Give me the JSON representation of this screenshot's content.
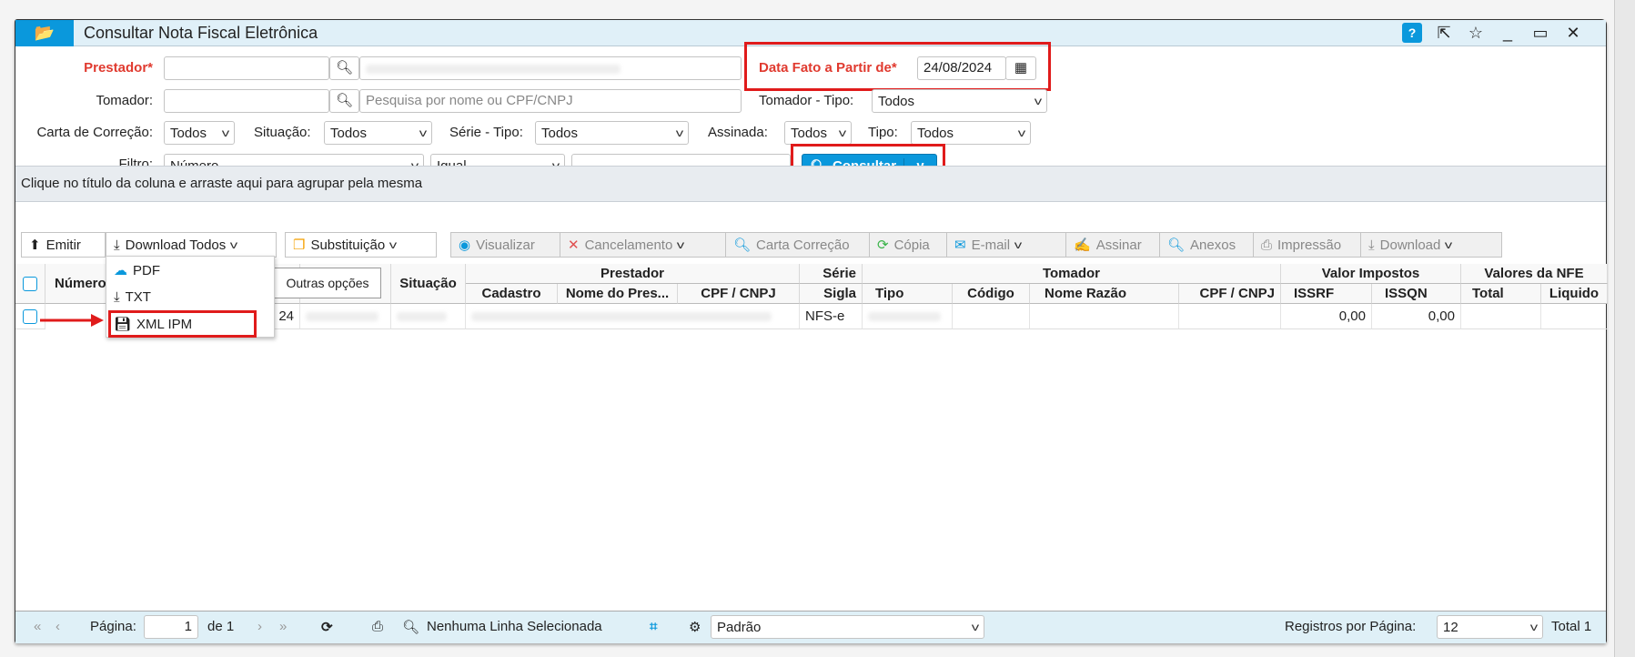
{
  "window": {
    "title": "Consultar Nota Fiscal Eletrônica",
    "help_label": "?"
  },
  "form": {
    "prestador_label": "Prestador*",
    "tomador_label": "Tomador:",
    "tomador_placeholder": "Pesquisa por nome ou CPF/CNPJ",
    "data_fato_label": "Data Fato a Partir de*",
    "data_fato_value": "24/08/2024",
    "tomador_tipo_label": "Tomador - Tipo:",
    "tomador_tipo_value": "Todos",
    "carta_label": "Carta de Correção:",
    "carta_value": "Todos",
    "situacao_label": "Situação:",
    "situacao_value": "Todos",
    "serie_label": "Série - Tipo:",
    "serie_value": "Todos",
    "assinada_label": "Assinada:",
    "assinada_value": "Todos",
    "tipo_label": "Tipo:",
    "tipo_value": "Todos",
    "filtro_label": "Filtro:",
    "filtro_field": "Número",
    "filtro_op": "Igual",
    "filtro_value": "",
    "consultar_label": "Consultar"
  },
  "group_hint": "Clique no título da coluna e arraste aqui para agrupar pela mesma",
  "toolbar": [
    "Emitir",
    "Download Todos",
    "Substituição",
    "Visualizar",
    "Cancelamento",
    "Carta Correção",
    "Cópia",
    "E-mail",
    "Assinar",
    "Anexos",
    "Impressão",
    "Download"
  ],
  "download_menu": [
    "PDF",
    "TXT",
    "XML IPM"
  ],
  "tooltip": "Outras opções",
  "table": {
    "groups": {
      "prestador": "Prestador",
      "serie": "Série",
      "tomador": "Tomador",
      "impostos": "Valor Impostos",
      "valores": "Valores da NFE"
    },
    "columns": {
      "numero": "Número",
      "situacao": "Situação",
      "cadastro": "Cadastro",
      "nome_prest": "Nome do Pres...",
      "cpf_prest": "CPF / CNPJ",
      "sigla": "Sigla",
      "tipo": "Tipo",
      "codigo": "Código",
      "nome_razao": "Nome Razão",
      "cpf_tom": "CPF / CNPJ",
      "issrf": "ISSRF",
      "issqn": "ISSQN",
      "total": "Total",
      "liquido": "Liquido"
    },
    "rows": [
      {
        "col2_tail": "24",
        "sigla": "NFS-e",
        "issrf": "0,00",
        "issqn": "0,00"
      }
    ]
  },
  "footer": {
    "page_label": "Página:",
    "page": "1",
    "of": "de 1",
    "selection": "Nenhuma Linha Selecionada",
    "layout": "Padrão",
    "per_page_label": "Registros por Página:",
    "per_page": "12",
    "total": "Total 1"
  },
  "colors": {
    "accent": "#0a98dc",
    "highlight": "#e01b1b",
    "required": "#e03a2f"
  }
}
